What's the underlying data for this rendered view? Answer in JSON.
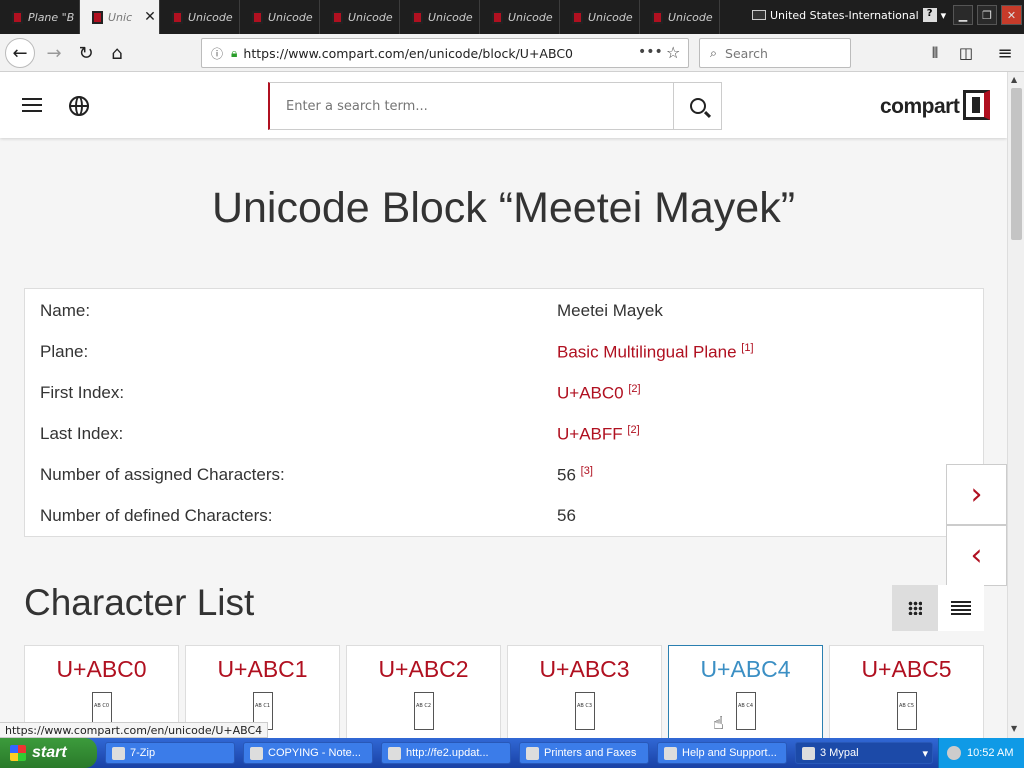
{
  "browser": {
    "tabs": [
      {
        "label": "Plane \"B"
      },
      {
        "label": "Unic"
      },
      {
        "label": "Unicode"
      },
      {
        "label": "Unicode"
      },
      {
        "label": "Unicode"
      },
      {
        "label": "Unicode"
      },
      {
        "label": "Unicode"
      },
      {
        "label": "Unicode"
      },
      {
        "label": "Unicode"
      }
    ],
    "tab_close": "✕",
    "language": "United States-International",
    "help_glyph": "?",
    "url": "https://www.compart.com/en/unicode/block/U+ABC0",
    "search_placeholder": "Search",
    "status_url": "https://www.compart.com/en/unicode/U+ABC4"
  },
  "site": {
    "search_placeholder": "Enter a search term...",
    "logo_text": "compart",
    "title": "Unicode Block “Meetei Mayek”",
    "info": [
      {
        "key": "Name:",
        "value": "Meetei Mayek",
        "link": false,
        "ref": ""
      },
      {
        "key": "Plane:",
        "value": "Basic Multilingual Plane",
        "link": true,
        "ref": "[1]"
      },
      {
        "key": "First Index:",
        "value": "U+ABC0",
        "link": true,
        "ref": "[2]"
      },
      {
        "key": "Last Index:",
        "value": "U+ABFF",
        "link": true,
        "ref": "[2]"
      },
      {
        "key": "Number of assigned Characters:",
        "value": "56",
        "link": false,
        "ref": "[3]"
      },
      {
        "key": "Number of defined Characters:",
        "value": "56",
        "link": false,
        "ref": ""
      }
    ],
    "next_arrow": "›",
    "prev_arrow": "‹",
    "char_list_title": "Character List",
    "cards": [
      {
        "code": "U+ABC0",
        "glyph": "AB C0"
      },
      {
        "code": "U+ABC1",
        "glyph": "AB C1"
      },
      {
        "code": "U+ABC2",
        "glyph": "AB C2"
      },
      {
        "code": "U+ABC3",
        "glyph": "AB C3"
      },
      {
        "code": "U+ABC4",
        "glyph": "AB C4"
      },
      {
        "code": "U+ABC5",
        "glyph": "AB C5"
      }
    ]
  },
  "taskbar": {
    "start": "start",
    "items": [
      {
        "label": "7-Zip"
      },
      {
        "label": "COPYING - Note..."
      },
      {
        "label": "http://fe2.updat..."
      },
      {
        "label": "Printers and Faxes"
      },
      {
        "label": "Help and Support..."
      },
      {
        "label": "3 Mypal"
      }
    ],
    "clock": "10:52 AM"
  }
}
